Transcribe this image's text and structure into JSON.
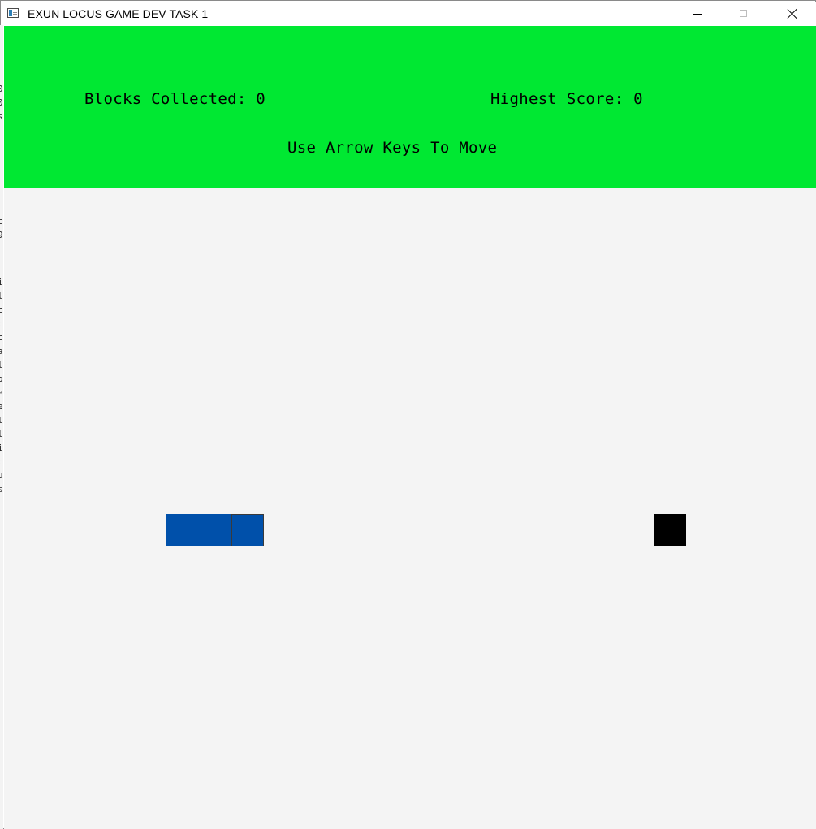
{
  "window": {
    "title": "EXUN LOCUS GAME DEV TASK 1",
    "controls": [
      "minimize",
      "maximize",
      "close"
    ]
  },
  "background_window_glyphs": [
    "0",
    "0",
    "s",
    "c",
    "9",
    "i",
    "l",
    "c",
    "c",
    "c",
    "a",
    "l",
    "o",
    "e",
    "e",
    "l",
    "l",
    "i",
    "c",
    "u",
    "s"
  ],
  "colors": {
    "hud_background": "#00e832",
    "play_area_background": "#f4f4f4",
    "snake_body": "#0050aa",
    "snake_head_outline": "#3a3a3a",
    "food_block": "#000000",
    "text": "#000000"
  },
  "hud": {
    "score_text": "Blocks Collected: 0",
    "high_score_text": "Highest Score: 0",
    "hint_text": "Use Arrow Keys To Move"
  },
  "game": {
    "grid_cell_size": 40,
    "snake": [
      {
        "col": 5,
        "row": 15
      },
      {
        "col": 6,
        "row": 15
      },
      {
        "col": 7,
        "row": 15
      }
    ],
    "food": {
      "col": 20,
      "row": 15
    }
  }
}
